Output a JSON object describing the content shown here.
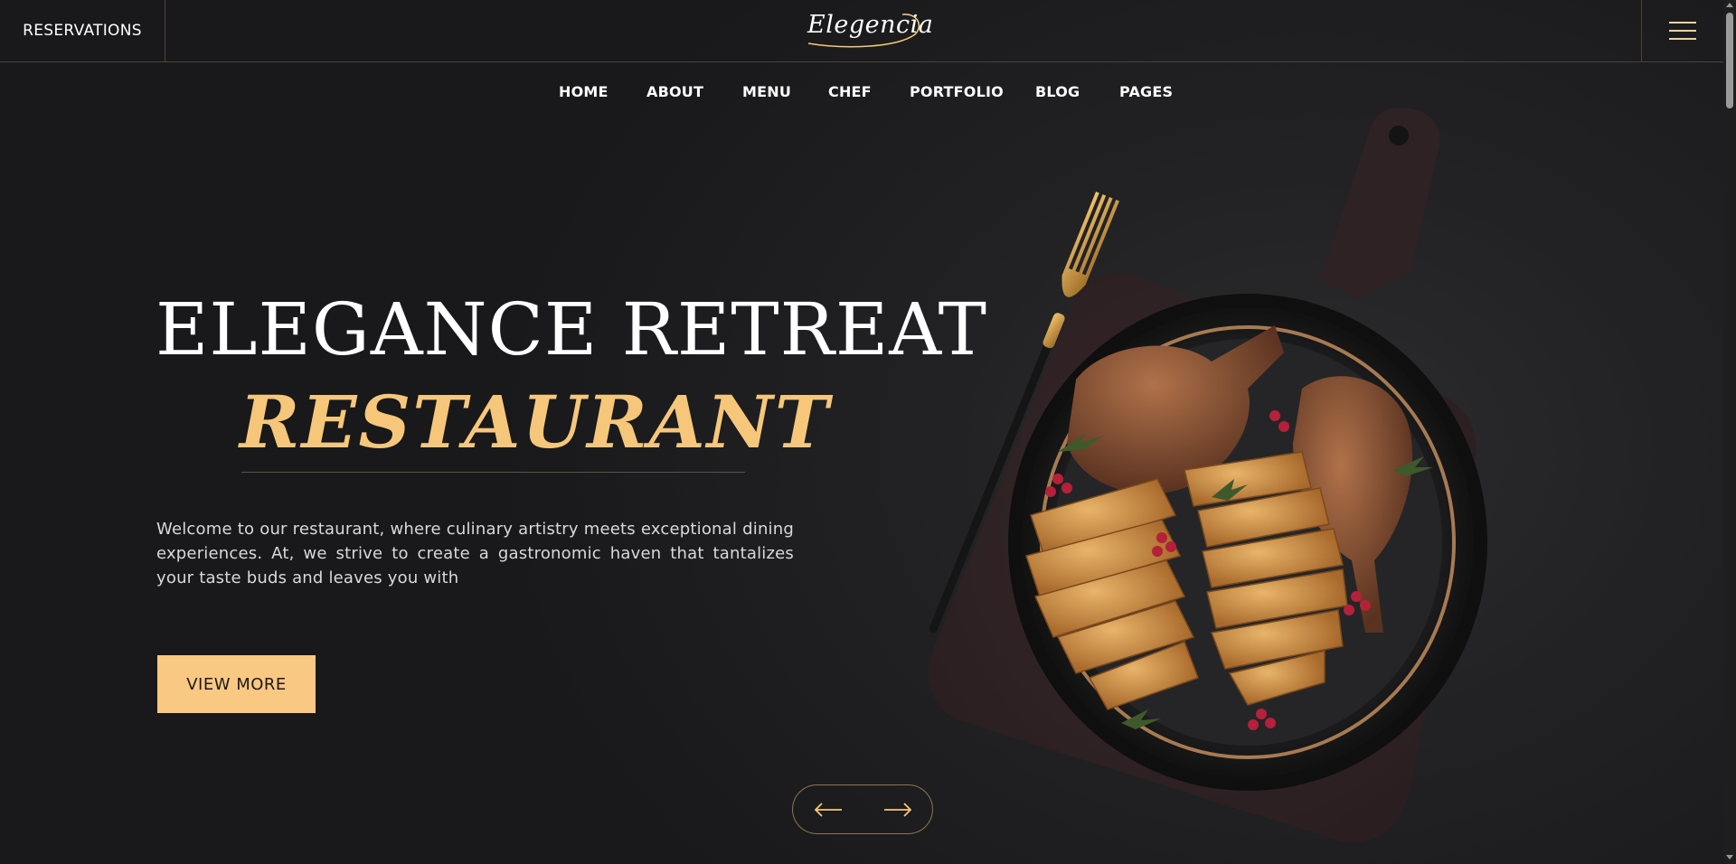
{
  "header": {
    "reservations_label": "RESERVATIONS",
    "logo_text": "Elegencia",
    "menu_icon": "hamburger-icon"
  },
  "nav": {
    "items": [
      "HOME",
      "ABOUT",
      "MENU",
      "CHEF",
      "PORTFOLIO",
      "BLOG",
      "PAGES"
    ]
  },
  "hero": {
    "title_line1": "ELEGANCE RETREAT",
    "title_line2": "RESTAURANT",
    "description": "Welcome to our restaurant, where culinary artistry meets exceptional dining experiences. At, we strive to create a gastronomic haven that tantalizes your taste buds and leaves you with",
    "cta_label": "VIEW MORE",
    "prev_icon": "arrow-left-icon",
    "next_icon": "arrow-right-icon",
    "image": "roast-turkey-platter-with-golden-fork"
  },
  "colors": {
    "accent": "#f9c883",
    "title_accent": "#f6c77b",
    "background": "#1b1b1d",
    "border": "#4a4436"
  }
}
